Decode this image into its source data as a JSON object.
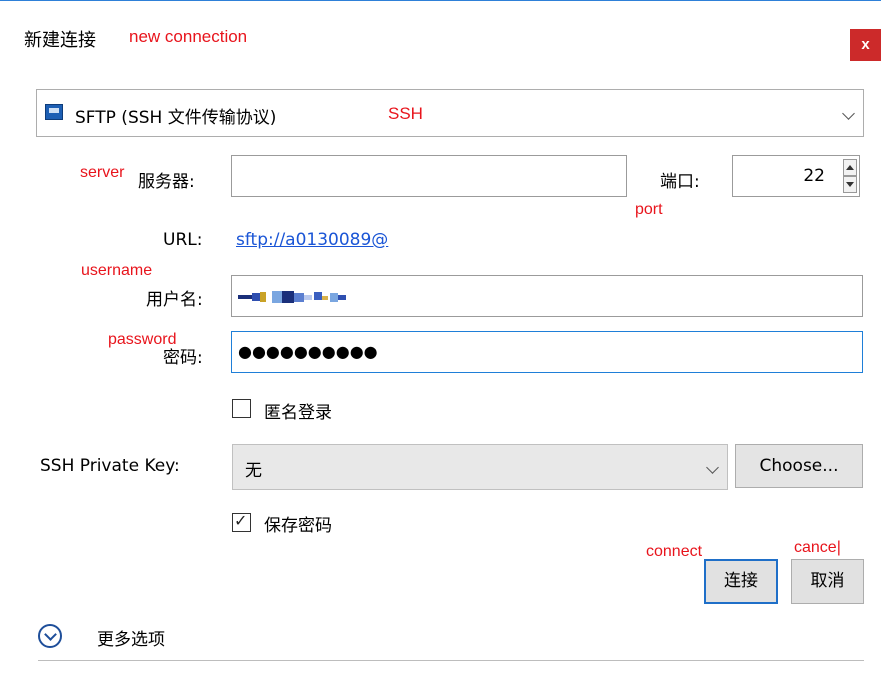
{
  "window": {
    "title": "新建连接",
    "title_annotation": "new connection",
    "close_label": "x"
  },
  "protocol": {
    "selected": "SFTP (SSH 文件传输协议)",
    "annotation": "SSH"
  },
  "server": {
    "label": "服务器:",
    "annotation": "server",
    "value": ""
  },
  "port": {
    "label": "端口:",
    "annotation": "port",
    "value": "22"
  },
  "url": {
    "label": "URL:",
    "value": "sftp://a0130089@"
  },
  "username": {
    "label": "用户名:",
    "annotation": "username"
  },
  "password": {
    "label": "密码:",
    "annotation": "password",
    "value": "●●●●●●●●●●"
  },
  "anonymous_login": {
    "label": "匿名登录",
    "checked": false
  },
  "private_key": {
    "label": "SSH Private Key:",
    "selected": "无",
    "choose_label": "Choose..."
  },
  "save_password": {
    "label": "保存密码",
    "checked": true,
    "check_glyph": "✓"
  },
  "buttons": {
    "connect_label": "连接",
    "connect_annotation": "connect",
    "cancel_label": "取消",
    "cancel_annotation": "cance|"
  },
  "more_options": {
    "label": "更多选项"
  }
}
